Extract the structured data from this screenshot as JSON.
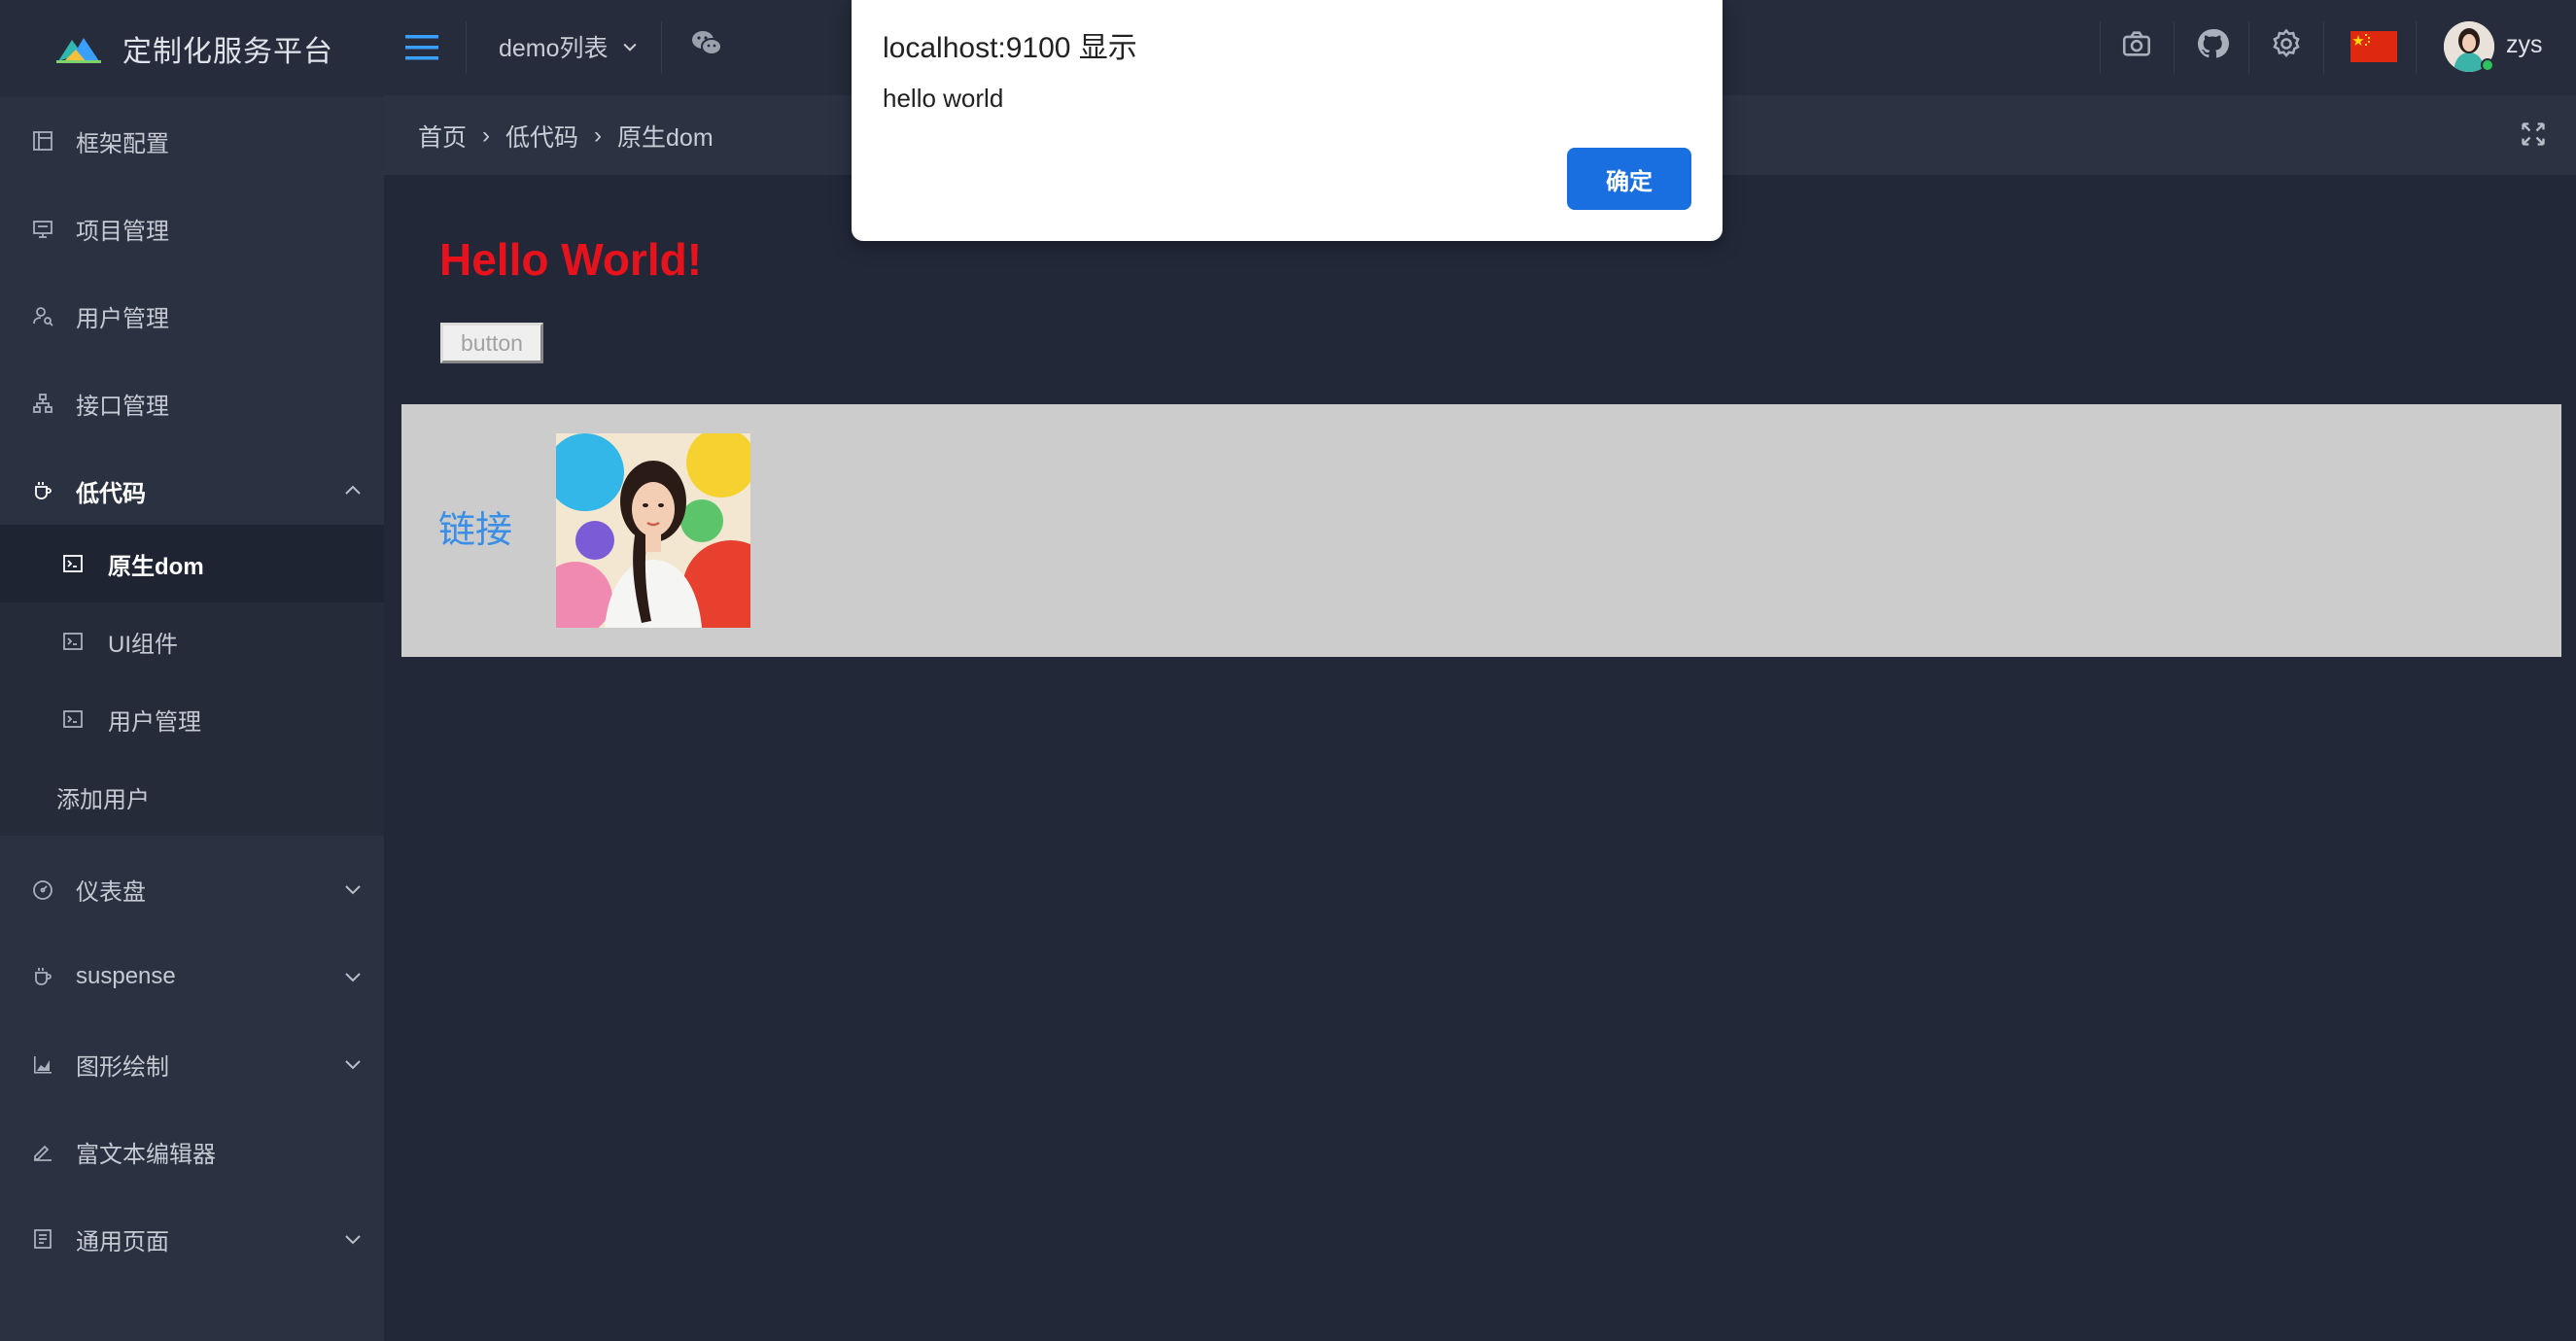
{
  "app": {
    "title": "定制化服务平台"
  },
  "sidebar": {
    "items": [
      {
        "label": "框架配置",
        "icon": "layout-icon"
      },
      {
        "label": "项目管理",
        "icon": "monitor-icon"
      },
      {
        "label": "用户管理",
        "icon": "user-icon"
      },
      {
        "label": "接口管理",
        "icon": "sitemap-icon"
      },
      {
        "label": "低代码",
        "icon": "cup-icon",
        "expanded": true
      },
      {
        "label": "仪表盘",
        "icon": "dashboard-icon"
      },
      {
        "label": "suspense",
        "icon": "cup-icon"
      },
      {
        "label": "图形绘制",
        "icon": "chart-icon"
      },
      {
        "label": "富文本编辑器",
        "icon": "edit-icon"
      },
      {
        "label": "通用页面",
        "icon": "page-icon"
      }
    ],
    "lowcode_children": [
      {
        "label": "原生dom",
        "icon": "terminal-icon",
        "active": true
      },
      {
        "label": "UI组件",
        "icon": "terminal-icon"
      },
      {
        "label": "用户管理",
        "icon": "terminal-icon"
      },
      {
        "label": "添加用户"
      }
    ]
  },
  "topbar": {
    "demo_menu": "demo列表",
    "icons": [
      "hamburger-icon",
      "wechat-icon",
      "camera-icon",
      "github-icon",
      "settings-icon",
      "china-flag-icon"
    ],
    "username": "zys"
  },
  "breadcrumb": [
    "首页",
    "低代码",
    "原生dom"
  ],
  "content": {
    "heading": "Hello World!",
    "button_label": "button",
    "link_text": "链接"
  },
  "dialog": {
    "title": "localhost:9100 显示",
    "message": "hello world",
    "ok_label": "确定"
  },
  "colors": {
    "accent": "#3aa0ff",
    "heading_red": "#e8121c",
    "link_blue": "#3a8ee6",
    "dialog_button": "#1a6fe0"
  }
}
